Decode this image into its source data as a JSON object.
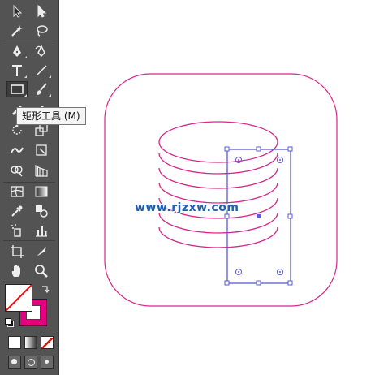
{
  "tooltip": {
    "text": "矩形工具 (M)"
  },
  "watermark": {
    "text": "www.rjzxw.com"
  },
  "colors": {
    "toolbar_bg": "#535353",
    "shape_stroke": "#d6268c",
    "selection": "#5b5bd6",
    "watermark": "#1a5fb4",
    "stroke_swatch": "#e4007f"
  },
  "tools": [
    "selection-tool",
    "direct-selection-tool",
    "magic-wand-tool",
    "lasso-tool",
    "pen-tool",
    "curvature-tool",
    "type-tool",
    "line-segment-tool",
    "rectangle-tool",
    "paintbrush-tool",
    "shaper-tool",
    "eraser-tool",
    "rotate-tool",
    "scale-tool",
    "width-tool",
    "free-transform-tool",
    "shape-builder-tool",
    "perspective-grid-tool",
    "mesh-tool",
    "gradient-tool",
    "eyedropper-tool",
    "blend-tool",
    "symbol-sprayer-tool",
    "column-graph-tool",
    "artboard-tool",
    "slice-tool",
    "hand-tool",
    "zoom-tool"
  ],
  "active_tool": "rectangle-tool"
}
